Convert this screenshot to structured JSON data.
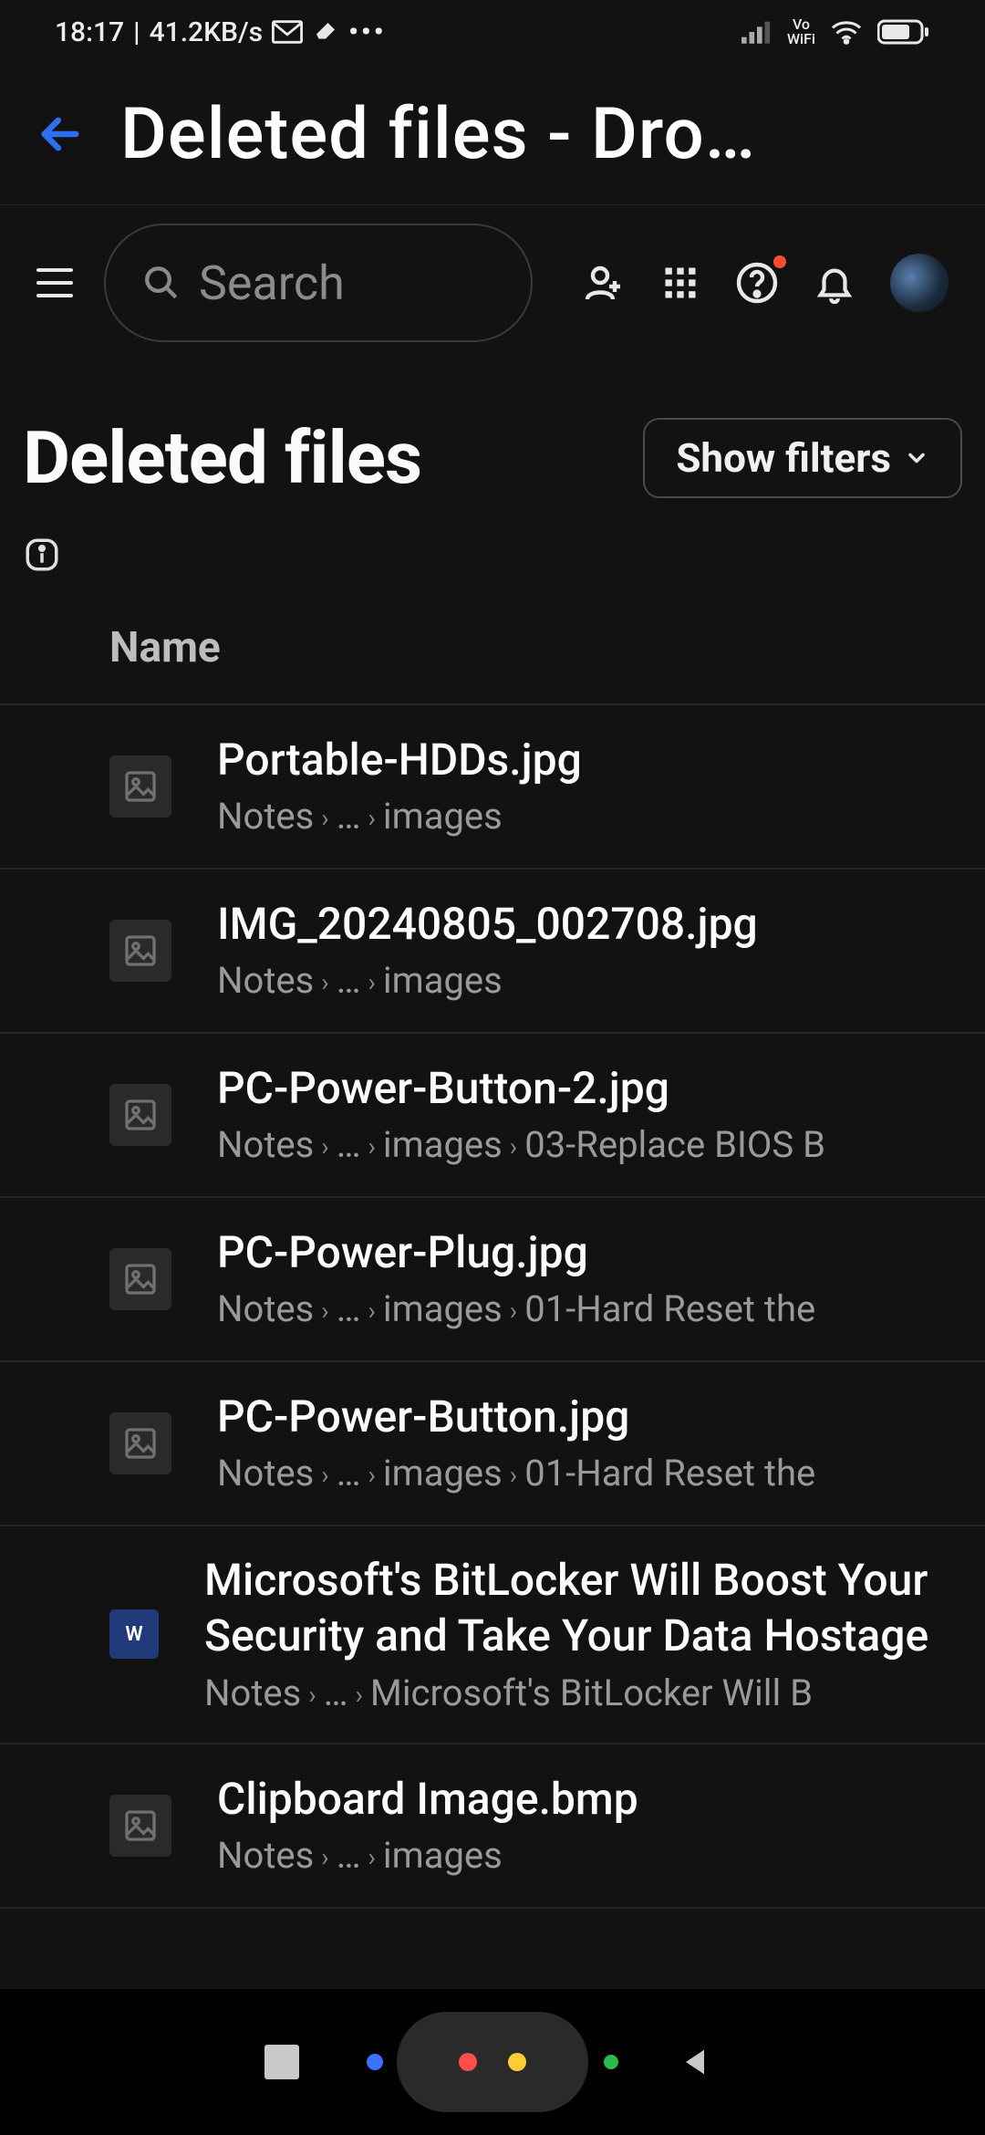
{
  "status_bar": {
    "time": "18:17",
    "net_speed": "41.2KB/s",
    "vowifi": "Vo\nWiFi"
  },
  "window": {
    "title": "Deleted files - Dro…"
  },
  "toolbar": {
    "search_placeholder": "Search"
  },
  "page": {
    "heading": "Deleted files",
    "show_filters_label": "Show filters",
    "column_name": "Name"
  },
  "files": [
    {
      "name": "Portable-HDDs.jpg",
      "path": [
        "Notes",
        "…",
        "images"
      ],
      "kind": "image"
    },
    {
      "name": "IMG_20240805_002708.jpg",
      "path": [
        "Notes",
        "…",
        "images"
      ],
      "kind": "image"
    },
    {
      "name": "PC-Power-Button-2.jpg",
      "path": [
        "Notes",
        "…",
        "images",
        "03-Replace BIOS B"
      ],
      "kind": "image"
    },
    {
      "name": "PC-Power-Plug.jpg",
      "path": [
        "Notes",
        "…",
        "images",
        "01-Hard Reset the"
      ],
      "kind": "image"
    },
    {
      "name": "PC-Power-Button.jpg",
      "path": [
        "Notes",
        "…",
        "images",
        "01-Hard Reset the"
      ],
      "kind": "image"
    },
    {
      "name": "Microsoft's BitLocker Will Boost Your Security and Take Your Data Hostage",
      "path": [
        "Notes",
        "…",
        "Microsoft's BitLocker Will B"
      ],
      "kind": "word"
    },
    {
      "name": "Clipboard Image.bmp",
      "path": [
        "Notes",
        "…",
        "images"
      ],
      "kind": "image"
    }
  ]
}
